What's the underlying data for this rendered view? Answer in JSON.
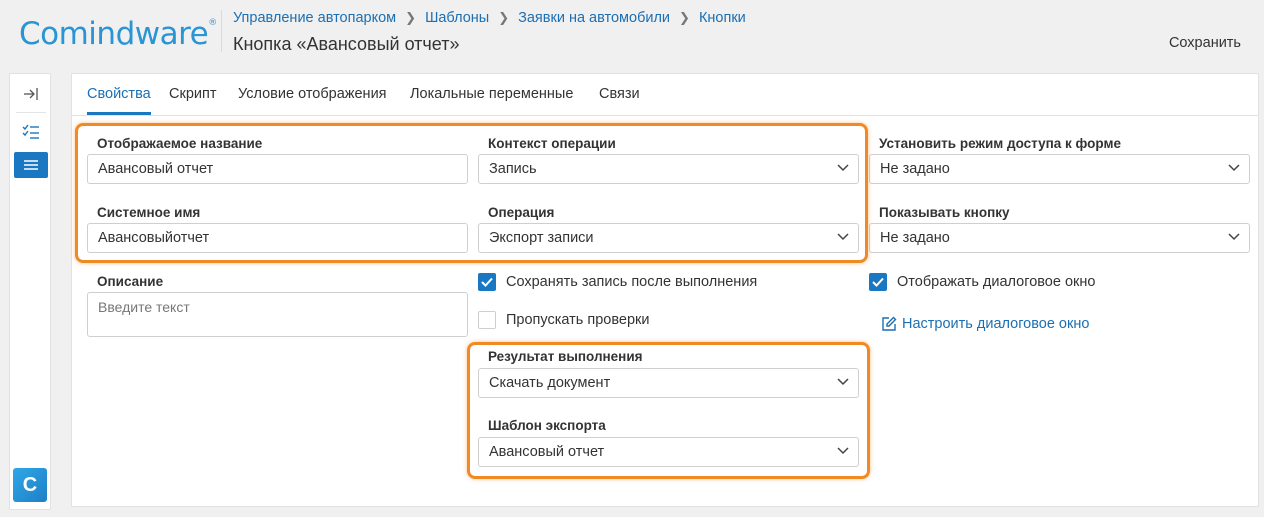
{
  "logo": {
    "text": "Comindware",
    "reg": "®"
  },
  "header": {
    "breadcrumbs": [
      "Управление автопарком",
      "Шаблоны",
      "Заявки на автомобили",
      "Кнопки"
    ],
    "title": "Кнопка «Авансовый отчет»",
    "save_label": "Сохранить"
  },
  "rail": {
    "icons": [
      "collapse-panel-icon",
      "checklist-icon",
      "list-icon"
    ],
    "app_logo": "C"
  },
  "tabs": [
    "Свойства",
    "Скрипт",
    "Условие отображения",
    "Локальные переменные",
    "Связи"
  ],
  "form": {
    "display_name": {
      "label": "Отображаемое название",
      "value": "Авансовый отчет"
    },
    "system_name": {
      "label": "Системное имя",
      "value": "Авансовыйотчет"
    },
    "description": {
      "label": "Описание",
      "placeholder": "Введите текст"
    },
    "operation_context": {
      "label": "Контекст операции",
      "value": "Запись"
    },
    "operation": {
      "label": "Операция",
      "value": "Экспорт записи"
    },
    "save_after": {
      "label": "Сохранять запись после выполнения",
      "checked": true
    },
    "skip_checks": {
      "label": "Пропускать проверки",
      "checked": false
    },
    "result": {
      "label": "Результат выполнения",
      "value": "Скачать документ"
    },
    "export_template": {
      "label": "Шаблон экспорта",
      "value": "Авансовый отчет"
    },
    "access_mode": {
      "label": "Установить режим доступа к форме",
      "value": "Не задано"
    },
    "show_button": {
      "label": "Показывать кнопку",
      "value": "Не задано"
    },
    "show_dialog": {
      "label": "Отображать диалоговое окно",
      "checked": true
    },
    "configure_dialog": {
      "label": "Настроить диалоговое окно"
    }
  },
  "colors": {
    "accent": "#1a78c2",
    "highlight": "#f08a24",
    "link": "#1c6fb3"
  }
}
